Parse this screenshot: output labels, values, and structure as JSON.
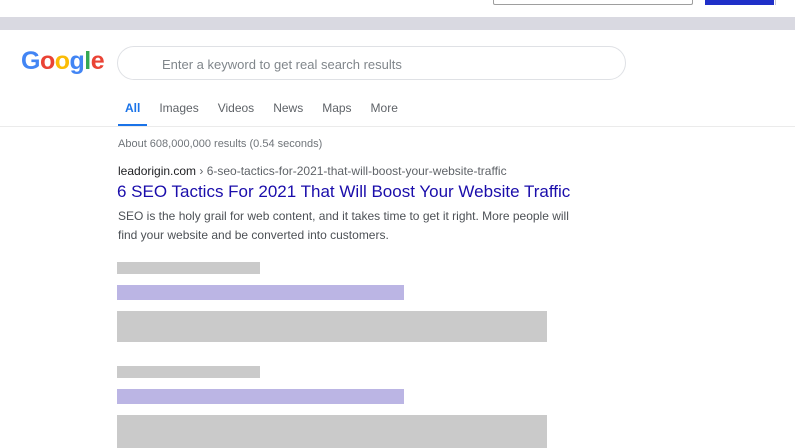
{
  "logo": {
    "letters": [
      "G",
      "o",
      "o",
      "g",
      "l",
      "e"
    ]
  },
  "search": {
    "placeholder": "Enter a keyword to get real search results",
    "value": ""
  },
  "tabs": [
    {
      "label": "All",
      "active": true
    },
    {
      "label": "Images",
      "active": false
    },
    {
      "label": "Videos",
      "active": false
    },
    {
      "label": "News",
      "active": false
    },
    {
      "label": "Maps",
      "active": false
    },
    {
      "label": "More",
      "active": false
    }
  ],
  "results": {
    "stats": "About 608,000,000 results (0.54 seconds)",
    "items": [
      {
        "domain": "leadorigin.com",
        "path": " › 6-seo-tactics-for-2021-that-will-boost-your-website-traffic",
        "title": "6 SEO Tactics For 2021 That Will Boost Your Website Traffic",
        "snippet": "SEO is the holy grail for web content, and it takes time to get it right. More people will find your website and be converted into customers."
      }
    ]
  },
  "colors": {
    "link_title": "#1a0dab",
    "tab_active": "#1a73e8",
    "placeholder_gray": "#cacaca",
    "placeholder_purple": "#bbb5e4",
    "top_button": "#1f2fc8"
  }
}
